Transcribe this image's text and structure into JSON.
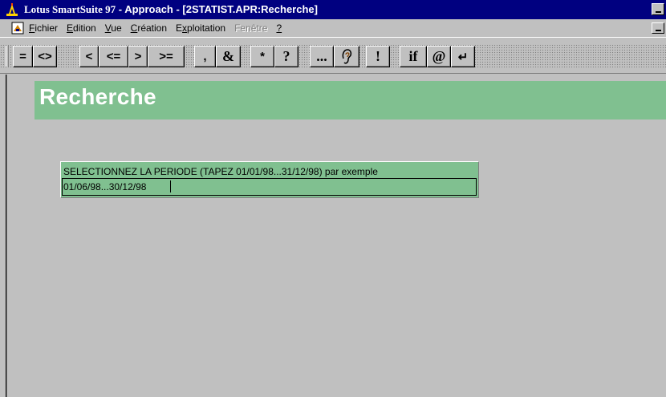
{
  "window": {
    "app_name": "Lotus SmartSuite 97",
    "separator": " - ",
    "doc_title": "Approach - [2STATIST.APR:Recherche]"
  },
  "menu": {
    "items": [
      {
        "label": "Fichier",
        "accel": "F",
        "rest": "ichier",
        "enabled": true
      },
      {
        "label": "Edition",
        "accel": "E",
        "rest": "dition",
        "enabled": true
      },
      {
        "label": "Vue",
        "accel": "V",
        "rest": "ue",
        "enabled": true
      },
      {
        "label": "Création",
        "accel": "C",
        "rest": "réation",
        "enabled": true
      },
      {
        "label": "Exploitation",
        "accel": "x",
        "pre": "E",
        "rest": "ploitation",
        "enabled": true
      },
      {
        "label": "Fenêtre",
        "enabled": false
      },
      {
        "label": "?",
        "enabled": true
      }
    ]
  },
  "toolbar": {
    "buttons": [
      "=",
      "<>",
      "<",
      "<=",
      ">",
      ">=",
      ",",
      "&",
      "*",
      "?",
      "...",
      "",
      "!",
      "if",
      "@",
      "↵"
    ]
  },
  "page": {
    "title": "Recherche"
  },
  "field": {
    "label": "SELECTIONNEZ LA PERIODE (TAPEZ 01/01/98...31/12/98) par exemple",
    "value": "01/06/98...30/12/98"
  },
  "colors": {
    "titlebar": "#000080",
    "accent_green": "#80c090",
    "face": "#c0c0c0"
  }
}
